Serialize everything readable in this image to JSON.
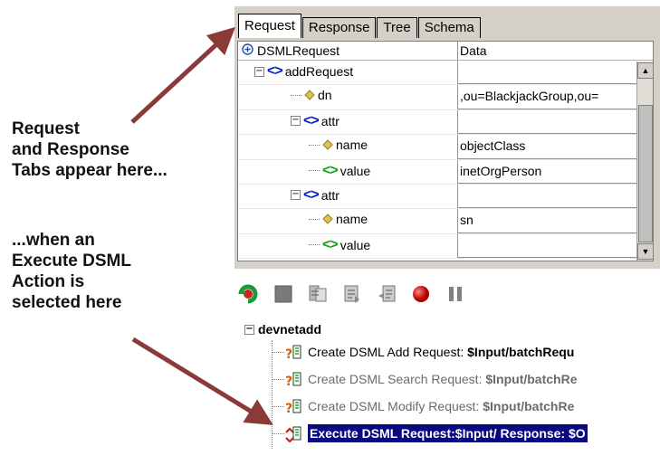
{
  "annotations": {
    "top_lines": [
      "Request",
      "and Response",
      "Tabs appear here..."
    ],
    "bottom_lines": [
      "...when an",
      "Execute DSML",
      "Action is",
      "selected here"
    ]
  },
  "editor": {
    "tabs": [
      {
        "label": "Request",
        "active": true
      },
      {
        "label": "Response",
        "active": false
      },
      {
        "label": "Tree",
        "active": false
      },
      {
        "label": "Schema",
        "active": false
      }
    ],
    "header": {
      "col1": "DSMLRequest",
      "col2": "Data"
    },
    "rows": [
      {
        "label": "addRequest",
        "kind": "element",
        "data": ""
      },
      {
        "label": "dn",
        "kind": "attribute",
        "data": ",ou=BlackjackGroup,ou="
      },
      {
        "label": "attr",
        "kind": "element",
        "data": ""
      },
      {
        "label": "name",
        "kind": "attribute",
        "data": "objectClass"
      },
      {
        "label": "value",
        "kind": "value",
        "data": "inetOrgPerson"
      },
      {
        "label": "attr",
        "kind": "element",
        "data": ""
      },
      {
        "label": "name",
        "kind": "attribute",
        "data": "sn"
      },
      {
        "label": "value",
        "kind": "value",
        "data": ""
      }
    ]
  },
  "toolbar": {
    "buttons": [
      "run-icon",
      "stop-icon",
      "step-into-icon",
      "step-over-icon",
      "step-out-icon",
      "breakpoint-icon",
      "pause-icon"
    ]
  },
  "tree": {
    "root": "devnetadd",
    "items": [
      {
        "prefix": "Create DSML Add Request: ",
        "bold": "$Input/batchRequ",
        "state": "normal"
      },
      {
        "prefix": "Create DSML Search Request: ",
        "bold": "$Input/batchRe",
        "state": "dim"
      },
      {
        "prefix": "Create DSML Modify Request: ",
        "bold": "$Input/batchRe",
        "state": "dim"
      },
      {
        "prefix": "",
        "bold": "Execute DSML Request:$Input/ Response: $O",
        "state": "selected"
      }
    ]
  },
  "colors": {
    "arrow": "#8b3a3a",
    "selection": "#0a0a80",
    "element_icon": "#0020c0",
    "value_icon": "#10a010"
  }
}
